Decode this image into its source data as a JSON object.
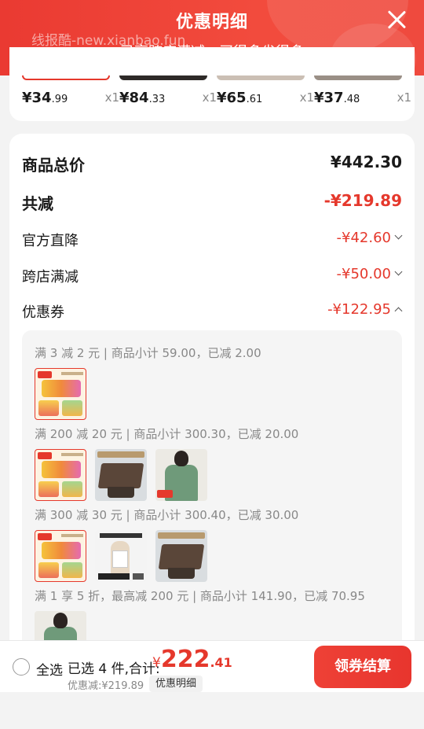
{
  "header": {
    "title": "优惠明细",
    "subtitle": "已享跨店满减，买得多省得多",
    "watermark": "线报酷-new.xianbao.fun"
  },
  "strip_items": [
    {
      "price_int": "¥34",
      "price_dec": ".99",
      "qty": "x1"
    },
    {
      "price_int": "¥84",
      "price_dec": ".33",
      "qty": "x1"
    },
    {
      "price_int": "¥65",
      "price_dec": ".61",
      "qty": "x1"
    },
    {
      "price_int": "¥37",
      "price_dec": ".48",
      "qty": "x1"
    }
  ],
  "summary": {
    "total_label": "商品总价",
    "total_value": "¥442.30",
    "reduce_label": "共减",
    "reduce_value": "-¥219.89",
    "official_label": "官方直降",
    "official_value": "-¥42.60",
    "cross_label": "跨店满减",
    "cross_value": "-¥50.00",
    "coupon_label": "优惠券",
    "coupon_value": "-¥122.95"
  },
  "coupons": [
    {
      "text": "满 3 减 2 元 | 商品小计 59.00，已减 2.00"
    },
    {
      "text": "满 200 减 20 元 | 商品小计 300.30，已减 20.00"
    },
    {
      "text": "满 300 减 30 元 | 商品小计 300.40，已减 30.00"
    },
    {
      "text": "满 1 享 5 折，最高减 200 元 | 商品小计 141.90，已减 70.95"
    }
  ],
  "bottom": {
    "select_all": "全选",
    "selected_summary": "已选 4 件,合计:",
    "price_symbol": "¥",
    "price_int": "222",
    "price_dec": ".41",
    "discount": "优惠减:¥219.89",
    "detail_chip": "优惠明细",
    "checkout": "领券结算"
  },
  "colors": {
    "brand_red": "#e5382c",
    "header_red": "#ea3a32"
  }
}
